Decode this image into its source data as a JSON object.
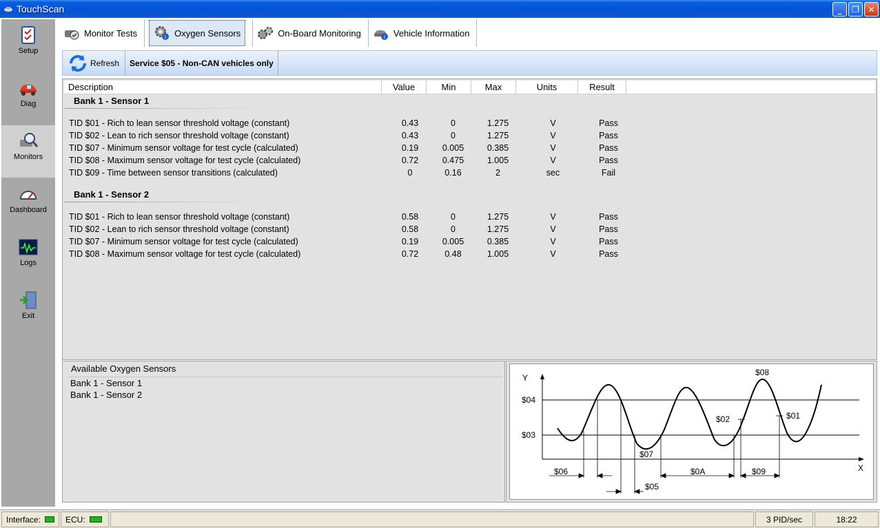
{
  "window": {
    "title": "TouchScan"
  },
  "sidebar": {
    "items": [
      {
        "label": "Setup"
      },
      {
        "label": "Diag"
      },
      {
        "label": "Monitors"
      },
      {
        "label": "Dashboard"
      },
      {
        "label": "Logs"
      },
      {
        "label": "Exit"
      }
    ]
  },
  "tabs": [
    {
      "label": "Monitor Tests"
    },
    {
      "label": "Oxygen Sensors"
    },
    {
      "label": "On-Board Monitoring"
    },
    {
      "label": "Vehicle Information"
    }
  ],
  "toolbar": {
    "refresh_label": "Refresh",
    "service_label": "Service $05 - Non-CAN vehicles only"
  },
  "table": {
    "columns": [
      "Description",
      "Value",
      "Min",
      "Max",
      "Units",
      "Result"
    ],
    "groups": [
      {
        "title": "Bank 1 - Sensor 1",
        "rows": [
          [
            "TID $01 - Rich to lean sensor threshold voltage (constant)",
            "0.43",
            "0",
            "1.275",
            "V",
            "Pass"
          ],
          [
            "TID $02 - Lean to rich sensor threshold voltage (constant)",
            "0.43",
            "0",
            "1.275",
            "V",
            "Pass"
          ],
          [
            "TID $07 - Minimum sensor voltage for test cycle (calculated)",
            "0.19",
            "0.005",
            "0.385",
            "V",
            "Pass"
          ],
          [
            "TID $08 - Maximum sensor voltage for test cycle (calculated)",
            "0.72",
            "0.475",
            "1.005",
            "V",
            "Pass"
          ],
          [
            "TID $09 - Time between sensor transitions (calculated)",
            "0",
            "0.16",
            "2",
            "sec",
            "Fail"
          ]
        ]
      },
      {
        "title": "Bank 1 - Sensor 2",
        "rows": [
          [
            "TID $01 - Rich to lean sensor threshold voltage (constant)",
            "0.58",
            "0",
            "1.275",
            "V",
            "Pass"
          ],
          [
            "TID $02 - Lean to rich sensor threshold voltage (constant)",
            "0.58",
            "0",
            "1.275",
            "V",
            "Pass"
          ],
          [
            "TID $07 - Minimum sensor voltage for test cycle (calculated)",
            "0.19",
            "0.005",
            "0.385",
            "V",
            "Pass"
          ],
          [
            "TID $08 - Maximum sensor voltage for test cycle (calculated)",
            "0.72",
            "0.48",
            "1.005",
            "V",
            "Pass"
          ]
        ]
      }
    ]
  },
  "sensors_panel": {
    "title": "Available Oxygen Sensors",
    "items": [
      "Bank 1 - Sensor 1",
      "Bank 1 - Sensor 2"
    ]
  },
  "diagram": {
    "y_label": "Y",
    "x_label": "X",
    "labels": {
      "l04": "$04",
      "l03": "$03",
      "l08": "$08",
      "l07": "$07",
      "l02": "$02",
      "l01": "$01",
      "l06": "$06",
      "l05": "$05",
      "l0a": "$0A",
      "l09": "$09"
    }
  },
  "statusbar": {
    "interface_label": "Interface:",
    "ecu_label": "ECU:",
    "rate": "3 PID/sec",
    "time": "18:22"
  },
  "colors": {
    "led_green": "#21B021",
    "title_blue": "#0454D8"
  }
}
